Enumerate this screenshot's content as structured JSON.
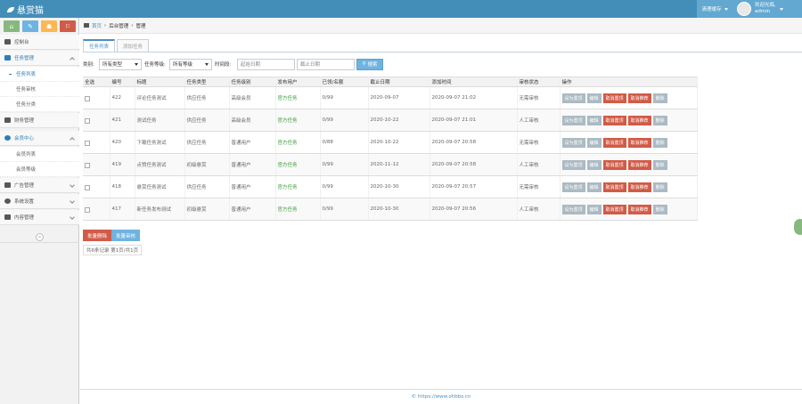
{
  "header": {
    "brand": "悬赏猫",
    "clear_cache": "清理缓存",
    "welcome": "欢迎光临,",
    "username": "admin"
  },
  "sidebar": {
    "shortcuts": [
      {
        "icon": "home-icon",
        "color": "#87b87f",
        "glyph": "⌂"
      },
      {
        "icon": "pencil-icon",
        "color": "#6fb3e0",
        "glyph": "✎"
      },
      {
        "icon": "users-icon",
        "color": "#ffb752",
        "glyph": "☗"
      },
      {
        "icon": "bell-icon",
        "color": "#d15b47",
        "glyph": "⚐"
      }
    ],
    "items": [
      {
        "label": "控制台"
      },
      {
        "label": "任务管理"
      },
      {
        "label": "任务列表"
      },
      {
        "label": "任务审核"
      },
      {
        "label": "任务分类"
      },
      {
        "label": "财务管理"
      },
      {
        "label": "会员中心"
      },
      {
        "label": "会员列表"
      },
      {
        "label": "会员等级"
      },
      {
        "label": "广告管理"
      },
      {
        "label": "系统设置"
      },
      {
        "label": "内容管理"
      }
    ],
    "collapse_glyph": "«"
  },
  "breadcrumb": {
    "home": "首页",
    "sep": "›",
    "level1": "后台管理",
    "level2": "管理"
  },
  "tabs": [
    "任务列表",
    "添加任务"
  ],
  "filter": {
    "category_label": "类别:",
    "category_value": "所有类型",
    "level_label": "任务等级:",
    "level_value": "所有等级",
    "time_label": "时间段:",
    "start_placeholder": "起始日期",
    "end_placeholder": "截止日期",
    "search_label": "搜索"
  },
  "table": {
    "headers": [
      "全选",
      "编号",
      "标题",
      "任务类型",
      "任务级别",
      "发布用户",
      "已领/名额",
      "截止日期",
      "添加时间",
      "审核状态",
      "操作"
    ],
    "rows": [
      {
        "id": "422",
        "title": "评论任务测试",
        "type": "供应任务",
        "level": "高级会员",
        "user": "官方任务",
        "user_green": true,
        "quota": "0/99",
        "deadline": "2020-09-07",
        "added": "2020-09-07 21:02",
        "status": "无需审核"
      },
      {
        "id": "421",
        "title": "测试任务",
        "type": "供应任务",
        "level": "高级会员",
        "user": "官方任务",
        "user_green": true,
        "quota": "0/99",
        "deadline": "2020-10-22",
        "added": "2020-09-07 21:01",
        "status": "人工审核"
      },
      {
        "id": "420",
        "title": "下载任务测试",
        "type": "供应任务",
        "level": "普通用户",
        "user": "官方任务",
        "user_green": true,
        "quota": "0/88",
        "deadline": "2020-10-22",
        "added": "2020-09-07 20:58",
        "status": "无需审核"
      },
      {
        "id": "419",
        "title": "点赞任务测试",
        "type": "初级悬赏",
        "level": "普通用户",
        "user": "官方任务",
        "user_green": true,
        "quota": "0/99",
        "deadline": "2020-11-12",
        "added": "2020-09-07 20:58",
        "status": "人工审核"
      },
      {
        "id": "418",
        "title": "悬赏任务测试",
        "type": "供应任务",
        "level": "普通用户",
        "user": "官方任务",
        "user_green": true,
        "quota": "0/99",
        "deadline": "2020-10-30",
        "added": "2020-09-07 20:57",
        "status": "无需审核"
      },
      {
        "id": "417",
        "title": "新任务发布测试",
        "type": "初级悬赏",
        "level": "普通用户",
        "user": "官方任务",
        "user_green": true,
        "quota": "0/99",
        "deadline": "2020-10-30",
        "added": "2020-09-07 20:56",
        "status": "人工审核"
      }
    ],
    "actions": [
      "设为置顶",
      "编辑",
      "取消置顶",
      "取消推荐",
      "删除"
    ]
  },
  "bulk": {
    "delete": "批量删除",
    "audit": "批量审核"
  },
  "pager": "共6条记录 第1页/共1页",
  "footer": "© https://www.ohbbs.cn"
}
